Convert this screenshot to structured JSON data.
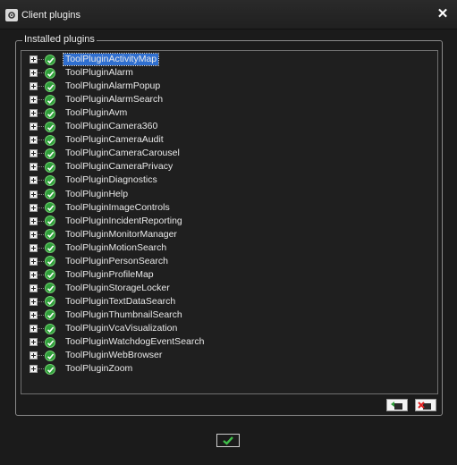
{
  "window": {
    "title": "Client plugins",
    "close_icon": "close-icon"
  },
  "group": {
    "label": "Installed plugins"
  },
  "plugins": [
    {
      "name": "ToolPluginActivityMap",
      "selected": true
    },
    {
      "name": "ToolPluginAlarm"
    },
    {
      "name": "ToolPluginAlarmPopup"
    },
    {
      "name": "ToolPluginAlarmSearch"
    },
    {
      "name": "ToolPluginAvm"
    },
    {
      "name": "ToolPluginCamera360"
    },
    {
      "name": "ToolPluginCameraAudit"
    },
    {
      "name": "ToolPluginCameraCarousel"
    },
    {
      "name": "ToolPluginCameraPrivacy"
    },
    {
      "name": "ToolPluginDiagnostics"
    },
    {
      "name": "ToolPluginHelp"
    },
    {
      "name": "ToolPluginImageControls"
    },
    {
      "name": "ToolPluginIncidentReporting"
    },
    {
      "name": "ToolPluginMonitorManager"
    },
    {
      "name": "ToolPluginMotionSearch"
    },
    {
      "name": "ToolPluginPersonSearch"
    },
    {
      "name": "ToolPluginProfileMap"
    },
    {
      "name": "ToolPluginStorageLocker"
    },
    {
      "name": "ToolPluginTextDataSearch"
    },
    {
      "name": "ToolPluginThumbnailSearch"
    },
    {
      "name": "ToolPluginVcaVisualization"
    },
    {
      "name": "ToolPluginWatchdogEventSearch"
    },
    {
      "name": "ToolPluginWebBrowser"
    },
    {
      "name": "ToolPluginZoom"
    }
  ],
  "colors": {
    "background": "#1b1b1b",
    "selection": "#2f6fd0",
    "status_ok": "#2f9e3a"
  },
  "icons": {
    "add_plugin": "add-plugin-icon",
    "remove_plugin": "remove-plugin-icon",
    "ok": "checkmark-icon",
    "status": "green-check-icon"
  }
}
